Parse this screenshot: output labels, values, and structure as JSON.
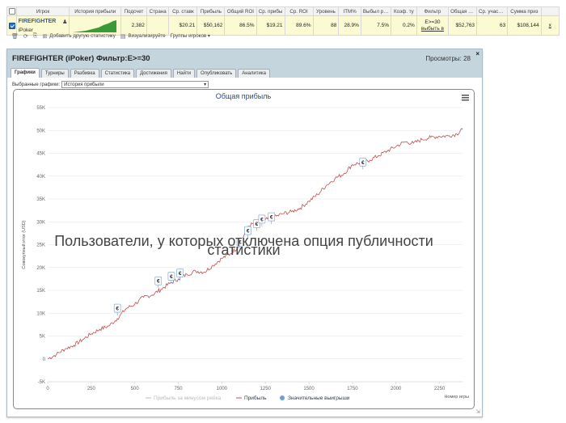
{
  "table": {
    "headers": [
      "Игрок",
      "История прибыли",
      "Подсчет",
      "Страна",
      "Ср. ставк",
      "Прибыль",
      "Общий ROI",
      "Ср. прибы",
      "Ср. ROI",
      "Уровень",
      "ITM%",
      "Выбыл рано",
      "Коэф. ту",
      "Фильтр",
      "Общая ста",
      "Ср. участни",
      "Сумма приз"
    ],
    "row": {
      "player_name": "FIREFIGHTER",
      "site": "iPoker",
      "count": "2,382",
      "country": "",
      "avg_stake": "$20.21",
      "profit": "$50,162",
      "total_roi": "86.5%",
      "avg_profit": "$19.21",
      "avg_roi": "89.6%",
      "level": "88",
      "itm": "28.9%",
      "early_out": "7.5%",
      "coef": "0.2%",
      "filter_line1": "E>=30",
      "filter_line2": "выбыть в",
      "total_stake": "$52,763",
      "avg_participants": "63",
      "prize_sum": "$108,144",
      "remove_label": "x"
    }
  },
  "toolbar": {
    "add_label": "Добавить другую статистику",
    "visualize_label": "Визуализируйте",
    "groups_label": "Группы игроков ▾"
  },
  "panel": {
    "title": "FIREFIGHTER (iPoker) Фильтр:E>=30",
    "views": "Просмотры: 28",
    "close": "×",
    "tabs": [
      "Графики",
      "Турниры",
      "Разбивка",
      "Статистика",
      "Достижения",
      "Найти",
      "Опубликовать",
      "Аналитика"
    ],
    "selected_label": "Выбранные графики:",
    "selected_value": "История прибыли"
  },
  "watermark_line1": "Пользователи, у которых отключена опция публичности",
  "watermark_line2": "статистики",
  "chart_data": {
    "type": "line",
    "title": "Общая прибыль",
    "xlabel": "Номер игры",
    "ylabel": "Совокупный итог (USD)",
    "xlim": [
      0,
      2382
    ],
    "ylim": [
      -5000,
      55000
    ],
    "x_ticks": [
      0,
      250,
      500,
      750,
      1000,
      1250,
      1500,
      1750,
      2000,
      2250
    ],
    "y_ticks": [
      -5000,
      0,
      5000,
      10000,
      15000,
      20000,
      25000,
      30000,
      35000,
      40000,
      45000,
      50000,
      55000
    ],
    "y_tick_labels": [
      "-5K",
      "0",
      "5K",
      "10K",
      "15K",
      "20K",
      "25K",
      "30K",
      "35K",
      "40K",
      "45K",
      "50K",
      "55K"
    ],
    "legend": [
      "Прибыль за минусом рейка",
      "Прибыль",
      "Значительные выигрыши"
    ],
    "legend_position": "bottom",
    "line_color": "#c0504d",
    "series": [
      {
        "name": "Прибыль",
        "x": [
          0,
          50,
          100,
          150,
          200,
          250,
          300,
          350,
          400,
          450,
          500,
          550,
          600,
          650,
          700,
          750,
          800,
          850,
          900,
          950,
          1000,
          1050,
          1100,
          1150,
          1200,
          1250,
          1300,
          1350,
          1400,
          1450,
          1500,
          1550,
          1600,
          1650,
          1700,
          1750,
          1800,
          1850,
          1900,
          1950,
          2000,
          2050,
          2100,
          2150,
          2200,
          2250,
          2300,
          2350,
          2382
        ],
        "y": [
          0,
          1000,
          2200,
          3000,
          4200,
          5500,
          6500,
          7200,
          8800,
          11000,
          12000,
          13500,
          14000,
          15200,
          16500,
          17500,
          18500,
          19200,
          19000,
          20500,
          22000,
          23000,
          24800,
          29000,
          30000,
          30500,
          31000,
          31800,
          32200,
          33000,
          34500,
          36000,
          38000,
          39500,
          40500,
          42500,
          43000,
          43500,
          44500,
          45500,
          46500,
          47500,
          47200,
          48000,
          48500,
          48700,
          48800,
          49200,
          50200
        ]
      }
    ],
    "big_wins": [
      {
        "x": 400,
        "y": 9500
      },
      {
        "x": 635,
        "y": 15500
      },
      {
        "x": 710,
        "y": 16500
      },
      {
        "x": 760,
        "y": 17200
      },
      {
        "x": 1105,
        "y": 24000
      },
      {
        "x": 1150,
        "y": 26500
      },
      {
        "x": 1200,
        "y": 28000
      },
      {
        "x": 1230,
        "y": 29000
      },
      {
        "x": 1285,
        "y": 29500
      },
      {
        "x": 1810,
        "y": 41500
      }
    ],
    "big_win_symbol": "€"
  }
}
